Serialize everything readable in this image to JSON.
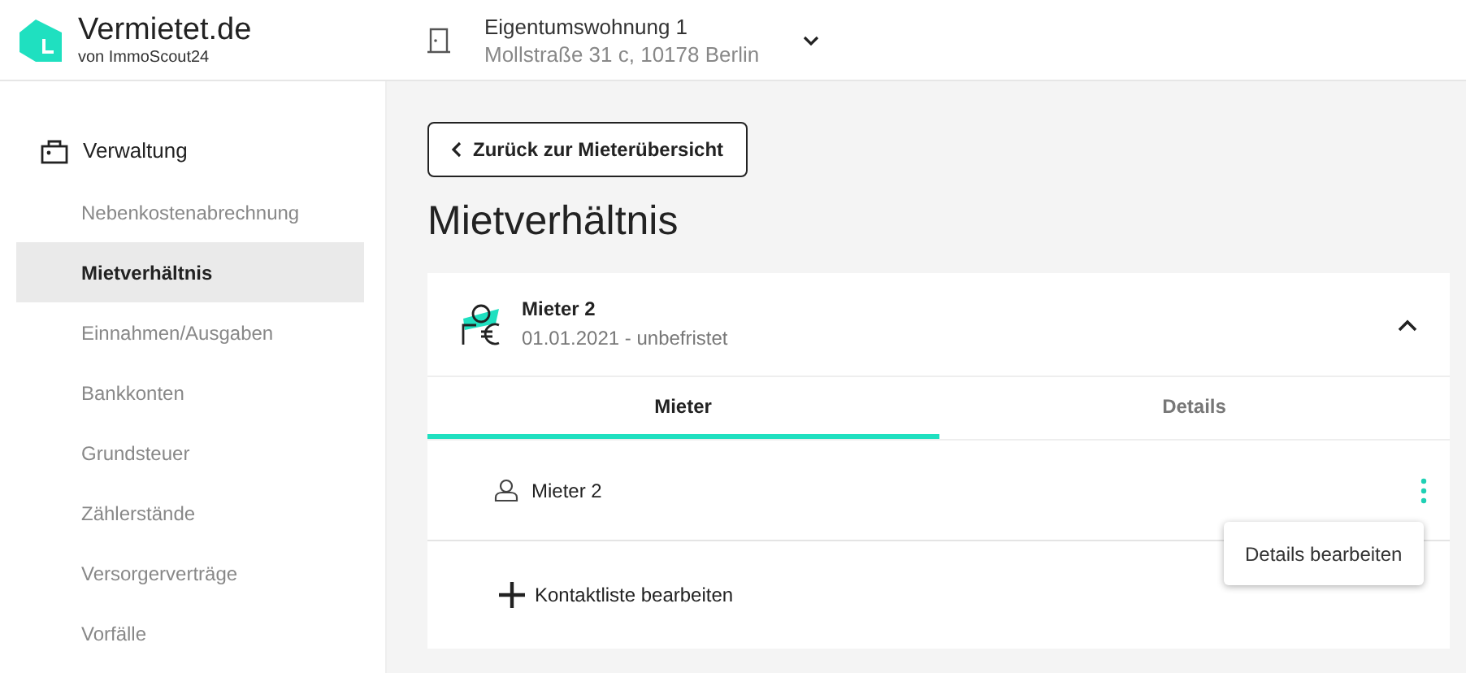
{
  "brand": {
    "name": "Vermietet.de",
    "tagline": "von ImmoScout24"
  },
  "property": {
    "title": "Eigentumswohnung 1",
    "address": "Mollstraße 31 c, 10178 Berlin"
  },
  "sidebar": {
    "section": "Verwaltung",
    "items": [
      {
        "label": "Nebenkostenabrechnung",
        "selected": false
      },
      {
        "label": "Mietverhältnis",
        "selected": true
      },
      {
        "label": "Einnahmen/Ausgaben",
        "selected": false
      },
      {
        "label": "Bankkonten",
        "selected": false
      },
      {
        "label": "Grundsteuer",
        "selected": false
      },
      {
        "label": "Zählerstände",
        "selected": false
      },
      {
        "label": "Versorgerverträge",
        "selected": false
      },
      {
        "label": "Vorfälle",
        "selected": false
      }
    ]
  },
  "back_button": "Zurück zur Mieterübersicht",
  "page_title": "Mietverhältnis",
  "tenancy": {
    "name": "Mieter 2",
    "period": "01.01.2021 - unbefristet",
    "expanded": true,
    "tabs": [
      {
        "label": "Mieter",
        "selected": true
      },
      {
        "label": "Details",
        "selected": false
      }
    ],
    "tenants": [
      {
        "name": "Mieter 2"
      }
    ],
    "add_contact": "Kontaktliste bearbeiten"
  },
  "context_menu": {
    "items": [
      "Details bearbeiten"
    ]
  }
}
